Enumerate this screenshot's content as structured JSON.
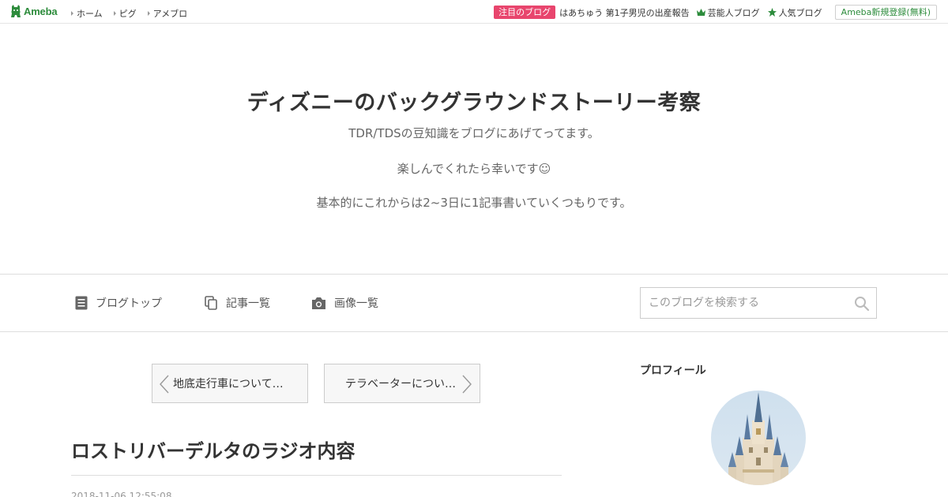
{
  "topbar": {
    "logo_text": "Ameba",
    "nav": [
      {
        "label": "ホーム"
      },
      {
        "label": "ピグ"
      },
      {
        "label": "アメブロ"
      }
    ],
    "hot_badge": "注目のブログ",
    "hot_link": "はあちゅう 第1子男児の出産報告",
    "celeb_link": "芸能人ブログ",
    "popular_link": "人気ブログ",
    "register_button": "Ameba新規登録(無料)"
  },
  "header": {
    "title": "ディズニーのバックグラウンドストーリー考察",
    "description": [
      "TDR/TDSの豆知識をブログにあげてってます。",
      "楽しんでくれたら幸いです☺",
      "基本的にこれからは2~3日に1記事書いていくつもりです。"
    ]
  },
  "nav": {
    "blog_top": "ブログトップ",
    "article_list": "記事一覧",
    "image_list": "画像一覧",
    "search_placeholder": "このブログを検索する"
  },
  "pager": {
    "prev_label": "地底走行車について…",
    "next_label": "テラベーターについ…"
  },
  "entry": {
    "title": "ロストリバーデルタのラジオ内容",
    "date": "2018-11-06 12:55:08"
  },
  "sidebar": {
    "profile_title": "プロフィール"
  },
  "colors": {
    "ameba_green": "#2d8c3c",
    "hot_pink": "#e8456d"
  }
}
